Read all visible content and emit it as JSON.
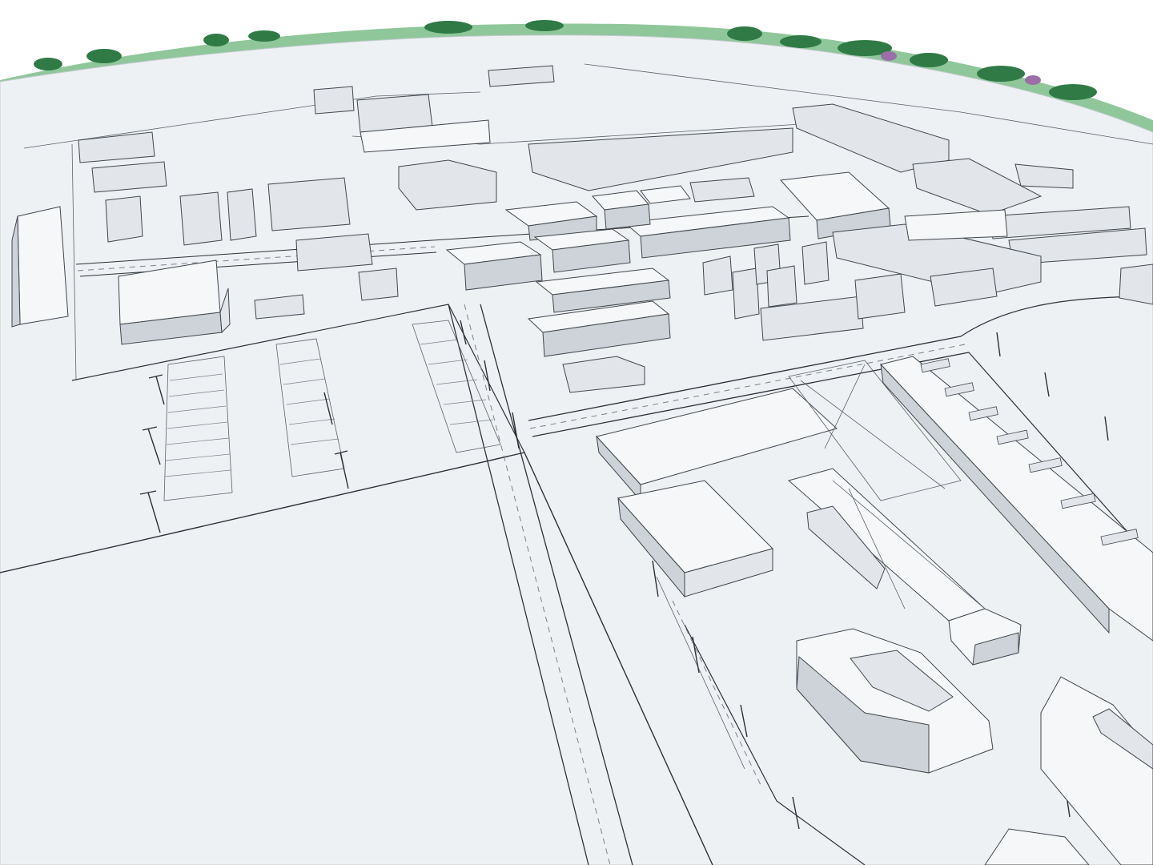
{
  "scene": {
    "subject": "",
    "colors": {
      "sky": "#ffffff",
      "ground": "#eef1f4",
      "ground_far": "#f4f6f8",
      "roof": "#f5f7f9",
      "wall_light": "#e2e6ea",
      "wall_dark": "#cdd3d9",
      "line": "#2c3136",
      "tree_dark": "#2f7a45",
      "tree_light": "#8fc79a",
      "tree_accent": "#9c6fa8"
    }
  }
}
